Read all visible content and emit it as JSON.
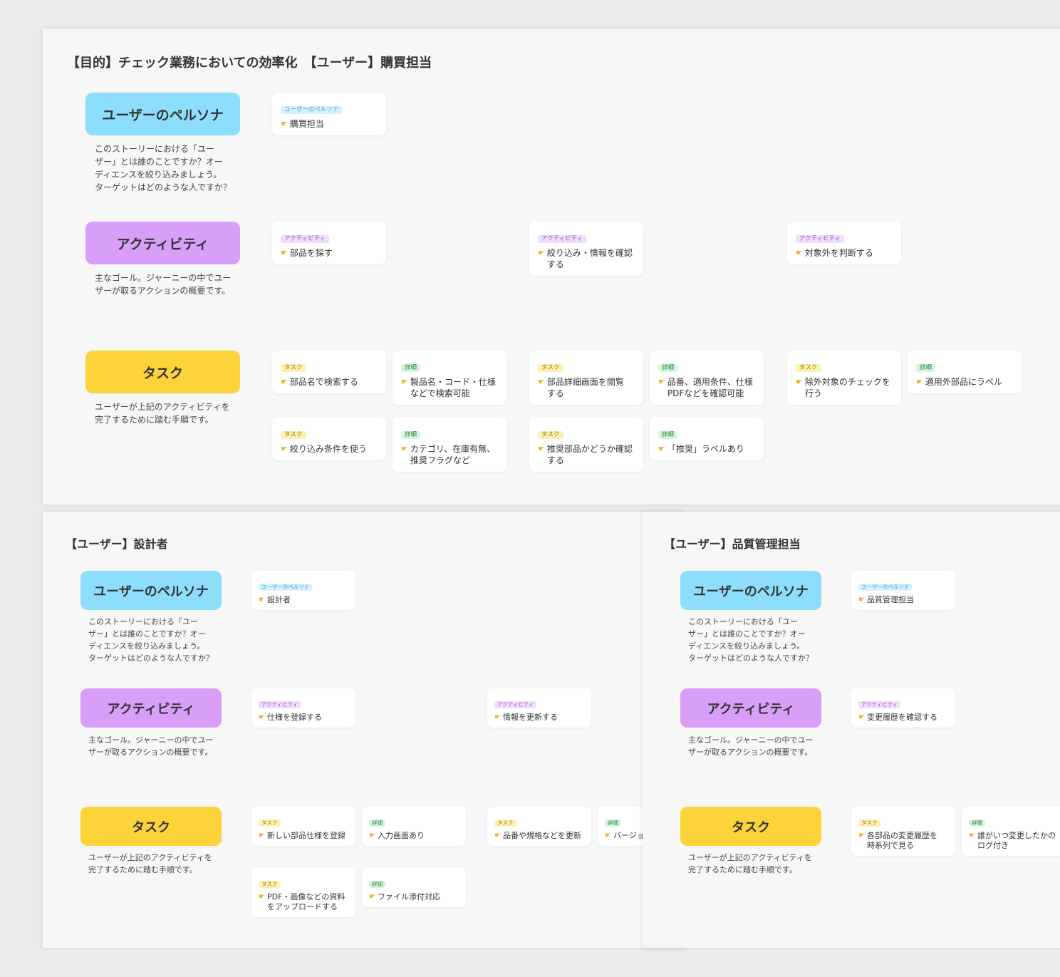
{
  "tags": {
    "persona": "ユーザーのペルソナ",
    "activity": "アクティビティ",
    "task": "タスク",
    "detail": "詳細"
  },
  "headers": {
    "persona": "ユーザーのペルソナ",
    "activity": "アクティビティ",
    "task": "タスク"
  },
  "descriptions": {
    "persona": [
      "このストーリーにおける「ユー",
      "ザー」とは誰のことですか？オー",
      "ディエンスを絞り込みましょう。",
      "ターゲットはどのような人ですか？"
    ],
    "activity": [
      "主なゴール。ジャーニーの中でユー",
      "ザーが取るアクションの概要です。"
    ],
    "task": [
      "ユーザーが上記のアクティビティを",
      "完了するために踏む手順です。"
    ]
  },
  "icons": {
    "pointer": "pointing-hand-icon"
  },
  "colors": {
    "persona": "#8ddefc",
    "activity": "#d89ef8",
    "task": "#fdd33a",
    "detail_tag": "#d6f5dc"
  },
  "boards": [
    {
      "id": "purchasing",
      "title": "【目的】チェック業務においての効率化　【ユーザー】購買担当",
      "persona": [
        "購買担当"
      ],
      "activities": [
        [
          "部品を探す"
        ],
        [
          "絞り込み・情報を確認",
          "する"
        ],
        [
          "対象外を判断する"
        ]
      ],
      "items": [
        [
          "部品名で検索する"
        ],
        [
          "製品名・コード・仕様",
          "などで検索可能"
        ],
        [
          "部品詳細画面を閲覧",
          "する"
        ],
        [
          "品番、適用条件、仕様",
          "PDFなどを確認可能"
        ],
        [
          "除外対象のチェックを",
          "行う"
        ],
        [
          "適用外部品にラベル"
        ],
        [
          "絞り込み条件を使う"
        ],
        [
          "カテゴリ、在庫有無、",
          "推奨フラグなど"
        ],
        [
          "推奨部品かどうか確認",
          "する"
        ],
        [
          "「推奨」ラベルあり"
        ]
      ]
    },
    {
      "id": "designer",
      "title": "【ユーザー】設計者",
      "persona": [
        "設計者"
      ],
      "activities": [
        [
          "仕様を登録する"
        ],
        [
          "情報を更新する"
        ]
      ],
      "items": [
        [
          "新しい部品仕様を登録"
        ],
        [
          "入力画面あり"
        ],
        [
          "品番や規格などを更新"
        ],
        [
          "バージョ"
        ],
        [
          "PDF・画像などの資料",
          "をアップロードする"
        ],
        [
          "ファイル添付対応"
        ]
      ]
    },
    {
      "id": "quality",
      "title": "【ユーザー】品質管理担当",
      "persona": [
        "品質管理担当"
      ],
      "activities": [
        [
          "変更履歴を確認する"
        ]
      ],
      "items": [
        [
          "各部品の変更履歴を",
          "時系列で見る"
        ],
        [
          "誰がいつ変更したかの",
          "ログ付き"
        ]
      ]
    }
  ]
}
